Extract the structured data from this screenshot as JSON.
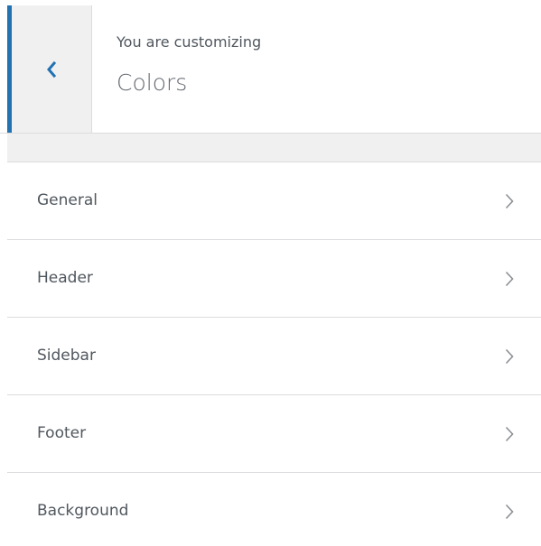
{
  "header": {
    "subtitle": "You are customizing",
    "title": "Colors",
    "back_icon": "chevron-left-icon"
  },
  "sections": [
    {
      "label": "General",
      "icon": "chevron-right-icon"
    },
    {
      "label": "Header",
      "icon": "chevron-right-icon"
    },
    {
      "label": "Sidebar",
      "icon": "chevron-right-icon"
    },
    {
      "label": "Footer",
      "icon": "chevron-right-icon"
    },
    {
      "label": "Background",
      "icon": "chevron-right-icon"
    }
  ],
  "colors": {
    "accent": "#2271b1",
    "panel_bg": "#f0f0f1",
    "border": "#dcdcde",
    "text": "#50575e"
  }
}
